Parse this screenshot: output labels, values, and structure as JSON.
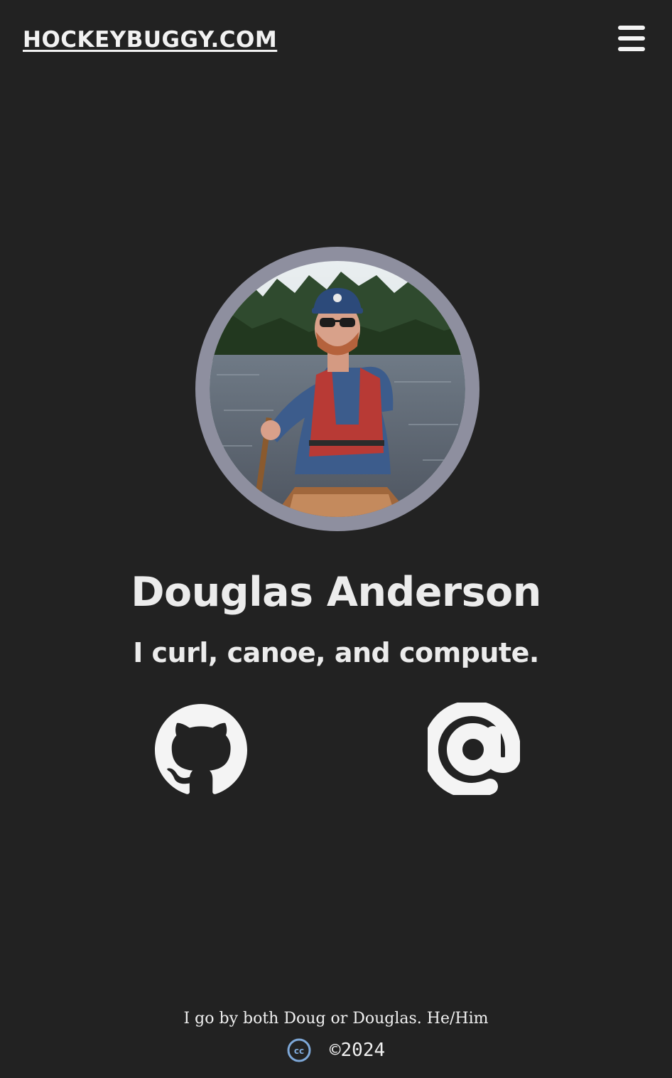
{
  "header": {
    "site_title": "HOCKEYBUGGY.COM",
    "menu_icon": "hamburger-menu-icon"
  },
  "profile": {
    "photo_description_icon": "profile-photo",
    "name": "Douglas Anderson",
    "tagline": "I curl, canoe, and compute."
  },
  "social": {
    "github_icon": "github-icon",
    "email_icon": "at-sign-icon"
  },
  "footer": {
    "note": "I go by both Doug or Douglas. He/Him",
    "license_icon": "creative-commons-icon",
    "copyright": "©2024"
  },
  "colors": {
    "background": "#222222",
    "text": "#eeeeee",
    "avatar_ring": "#8e8f9f",
    "cc_accent": "#7ea8d8"
  }
}
